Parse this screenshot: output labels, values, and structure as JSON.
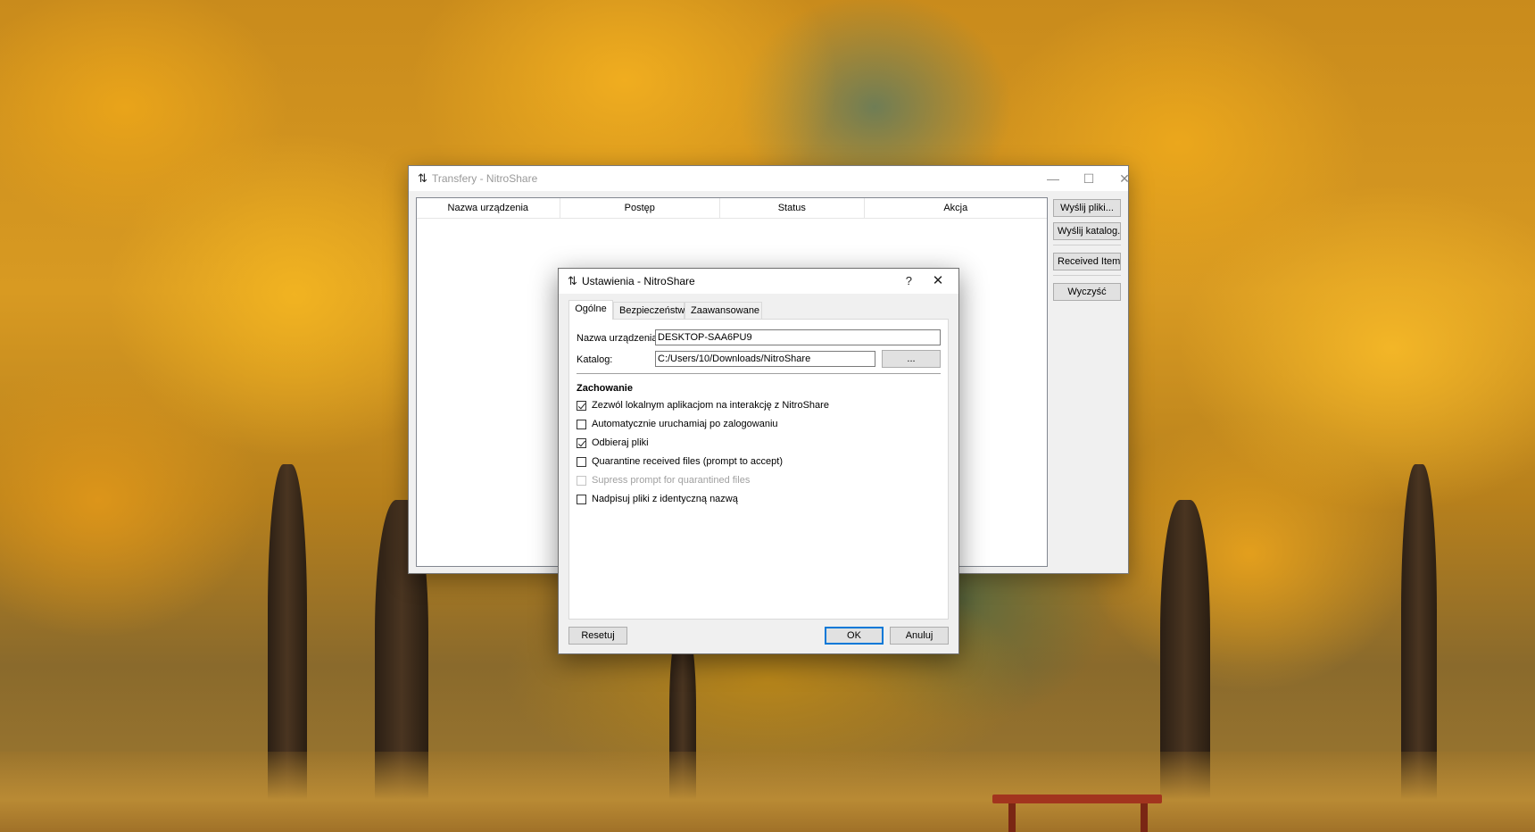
{
  "main_window": {
    "title": "Transfery - NitroShare",
    "controls": {
      "minimize": "—",
      "maximize": "☐",
      "close": "✕"
    },
    "table": {
      "columns": [
        "Nazwa urządzenia",
        "Postęp",
        "Status",
        "Akcja"
      ]
    },
    "buttons": {
      "send_files": "Wyślij pliki...",
      "send_directory": "Wyślij katalog...",
      "received_items": "Received Items",
      "clear": "Wyczyść"
    }
  },
  "settings_dialog": {
    "title": "Ustawienia - NitroShare",
    "help": "?",
    "close": "✕",
    "tabs": [
      "Ogólne",
      "Bezpieczeństwo",
      "Zaawansowane"
    ],
    "active_tab": "Ogólne",
    "device_name": {
      "label": "Nazwa urządzenia:",
      "value": "DESKTOP-SAA6PU9"
    },
    "directory": {
      "label": "Katalog:",
      "value": "C:/Users/10/Downloads/NitroShare",
      "browse": "..."
    },
    "behavior": {
      "title": "Zachowanie",
      "options": [
        {
          "label": "Zezwól lokalnym aplikacjom na interakcję z NitroShare",
          "checked": true,
          "enabled": true
        },
        {
          "label": "Automatycznie uruchamiaj po zalogowaniu",
          "checked": false,
          "enabled": true
        },
        {
          "label": "Odbieraj pliki",
          "checked": true,
          "enabled": true
        },
        {
          "label": "Quarantine received files (prompt to accept)",
          "checked": false,
          "enabled": true
        },
        {
          "label": "Supress prompt for quarantined files",
          "checked": false,
          "enabled": false
        },
        {
          "label": "Nadpisuj pliki z identyczną nazwą",
          "checked": false,
          "enabled": true
        }
      ]
    },
    "buttons": {
      "reset": "Resetuj",
      "ok": "OK",
      "cancel": "Anuluj"
    }
  },
  "icons": {
    "app": "nitroshare-icon"
  }
}
